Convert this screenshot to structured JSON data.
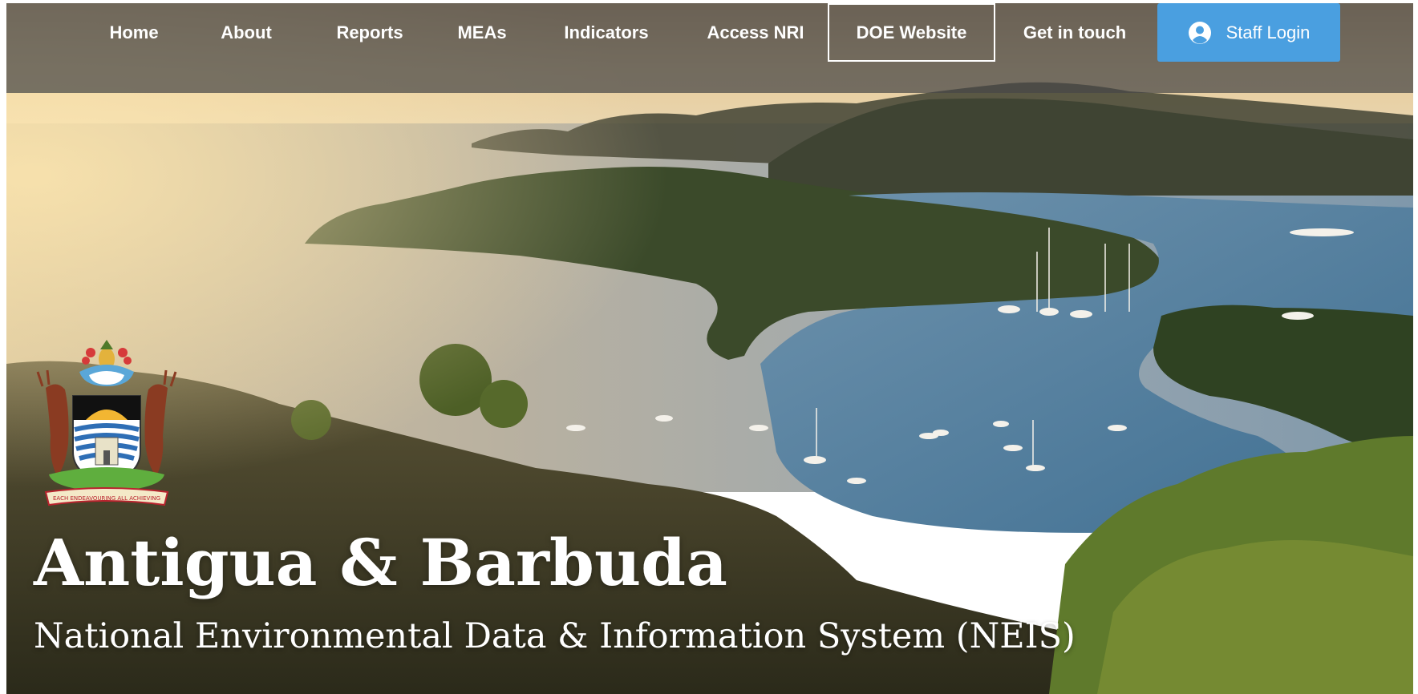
{
  "nav": {
    "items": [
      {
        "label": "Home"
      },
      {
        "label": "About"
      },
      {
        "label": "Reports"
      },
      {
        "label": "MEAs"
      },
      {
        "label": "Indicators"
      },
      {
        "label": "Access NRI"
      },
      {
        "label": "DOE Website",
        "outlined": true
      },
      {
        "label": "Get in touch"
      }
    ],
    "login": {
      "label": "Staff Login",
      "icon": "user-circle-icon",
      "color": "#4a9fe0"
    }
  },
  "hero": {
    "title": "Antigua & Barbuda",
    "subtitle": "National Environmental Data & Information System (NEIS)",
    "crest": {
      "icon": "coat-of-arms-icon",
      "motto": "EACH ENDEAVOURING ALL ACHIEVING"
    }
  },
  "colors": {
    "navbar_overlay": "#464646",
    "accent": "#4a9fe0",
    "text": "#ffffff"
  }
}
